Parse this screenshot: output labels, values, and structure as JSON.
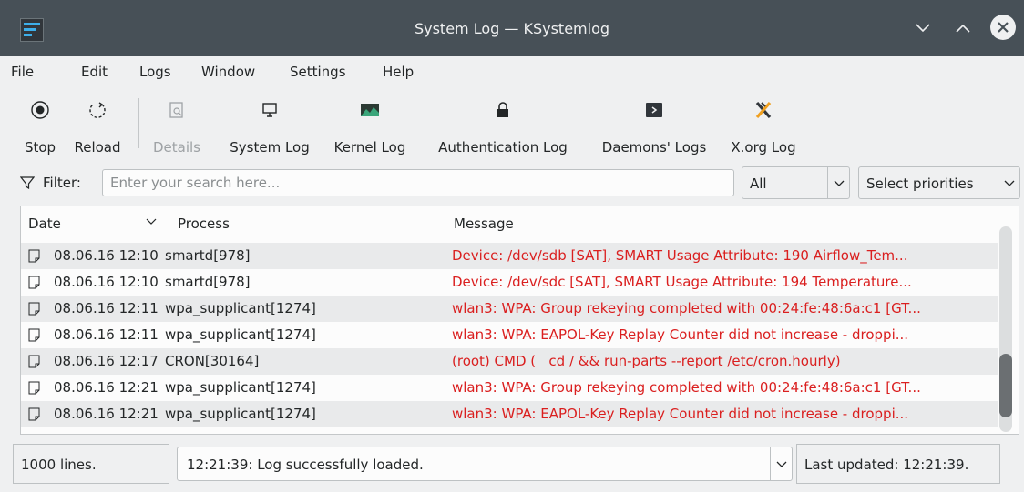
{
  "window": {
    "title": "System Log — KSystemlog"
  },
  "menu": [
    "File",
    "Edit",
    "Logs",
    "Window",
    "Settings",
    "Help"
  ],
  "toolbar": {
    "stop": "Stop",
    "reload": "Reload",
    "details": "Details",
    "system_log": "System Log",
    "kernel_log": "Kernel Log",
    "auth_log": "Authentication Log",
    "daemons_logs": "Daemons' Logs",
    "xorg_log": "X.org Log"
  },
  "filter": {
    "label": "Filter:",
    "placeholder": "Enter your search here...",
    "column_value": "All",
    "priorities": "Select priorities"
  },
  "table": {
    "headers": {
      "date": "Date",
      "process": "Process",
      "message": "Message"
    },
    "rows": [
      {
        "date": "08.06.16 12:10",
        "process": "smartd[978]",
        "message": "Device: /dev/sdb [SAT], SMART Usage Attribute: 190 Airflow_Tem..."
      },
      {
        "date": "08.06.16 12:10",
        "process": "smartd[978]",
        "message": "Device: /dev/sdc [SAT], SMART Usage Attribute: 194 Temperature..."
      },
      {
        "date": "08.06.16 12:11",
        "process": "wpa_supplicant[1274]",
        "message": "wlan3: WPA: Group rekeying completed with 00:24:fe:48:6a:c1 [GT..."
      },
      {
        "date": "08.06.16 12:11",
        "process": "wpa_supplicant[1274]",
        "message": "wlan3: WPA: EAPOL-Key Replay Counter did not increase - droppi..."
      },
      {
        "date": "08.06.16 12:17",
        "process": "CRON[30164]",
        "message": "(root) CMD (   cd / && run-parts --report /etc/cron.hourly)"
      },
      {
        "date": "08.06.16 12:21",
        "process": "wpa_supplicant[1274]",
        "message": "wlan3: WPA: Group rekeying completed with 00:24:fe:48:6a:c1 [GT..."
      },
      {
        "date": "08.06.16 12:21",
        "process": "wpa_supplicant[1274]",
        "message": "wlan3: WPA: EAPOL-Key Replay Counter did not increase - droppi..."
      }
    ]
  },
  "status": {
    "lines": "1000 lines.",
    "message": "12:21:39: Log successfully loaded.",
    "updated": "Last updated: 12:21:39."
  },
  "colors": {
    "titlebar": "#475057",
    "message_text": "#da1f1f",
    "accent": "#3daee9"
  }
}
